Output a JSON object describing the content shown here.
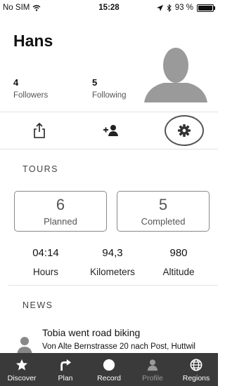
{
  "status_bar": {
    "carrier": "No SIM",
    "time": "15:28",
    "battery_text": "93 %",
    "battery_level": 0.93
  },
  "profile": {
    "name": "Hans",
    "followers_count": "4",
    "followers_label": "Followers",
    "following_count": "5",
    "following_label": "Following"
  },
  "actions": {
    "share_icon": "share-icon",
    "add_friend_icon": "add-person-icon",
    "settings_icon": "gear-icon"
  },
  "tours": {
    "section_title": "TOURS",
    "planned_count": "6",
    "planned_label": "Planned",
    "completed_count": "5",
    "completed_label": "Completed",
    "hours_value": "04:14",
    "hours_label": "Hours",
    "km_value": "94,3",
    "km_label": "Kilometers",
    "altitude_value": "980",
    "altitude_label": "Altitude"
  },
  "news": {
    "section_title": "NEWS",
    "items": [
      {
        "title": "Tobia went road biking",
        "subtitle": "Von Alte Bernstrasse 20 nach Post, Huttwil"
      }
    ]
  },
  "tab_bar": {
    "background": "#3a3a3a",
    "tabs": [
      {
        "label": "Discover",
        "icon": "star-icon"
      },
      {
        "label": "Plan",
        "icon": "turn-arrow-icon"
      },
      {
        "label": "Record",
        "icon": "record-dot-icon"
      },
      {
        "label": "Profile",
        "icon": "person-icon",
        "active": true
      },
      {
        "label": "Regions",
        "icon": "globe-icon"
      }
    ]
  }
}
